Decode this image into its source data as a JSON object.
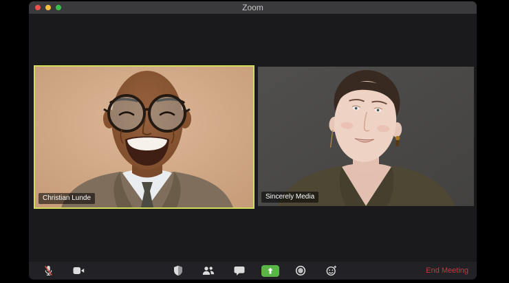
{
  "window": {
    "title": "Zoom"
  },
  "participants": [
    {
      "name": "Christian Lunde",
      "active_speaker": true
    },
    {
      "name": "Sincerely Media",
      "active_speaker": false
    }
  ],
  "toolbar": {
    "buttons": [
      {
        "icon": "microphone-muted-icon"
      },
      {
        "icon": "video-camera-icon"
      },
      {
        "icon": "security-shield-icon"
      },
      {
        "icon": "participants-icon"
      },
      {
        "icon": "chat-icon"
      },
      {
        "icon": "share-screen-icon"
      },
      {
        "icon": "record-icon"
      },
      {
        "icon": "reactions-icon"
      }
    ],
    "end_meeting_label": "End Meeting"
  },
  "colors": {
    "active_speaker_border": "#d4dc5c",
    "share_screen_green": "#58b546",
    "end_meeting_red": "#c43a40",
    "traffic_light_red": "#ee4f4c",
    "traffic_light_yellow": "#f5bd3c",
    "traffic_light_green": "#38c149"
  }
}
